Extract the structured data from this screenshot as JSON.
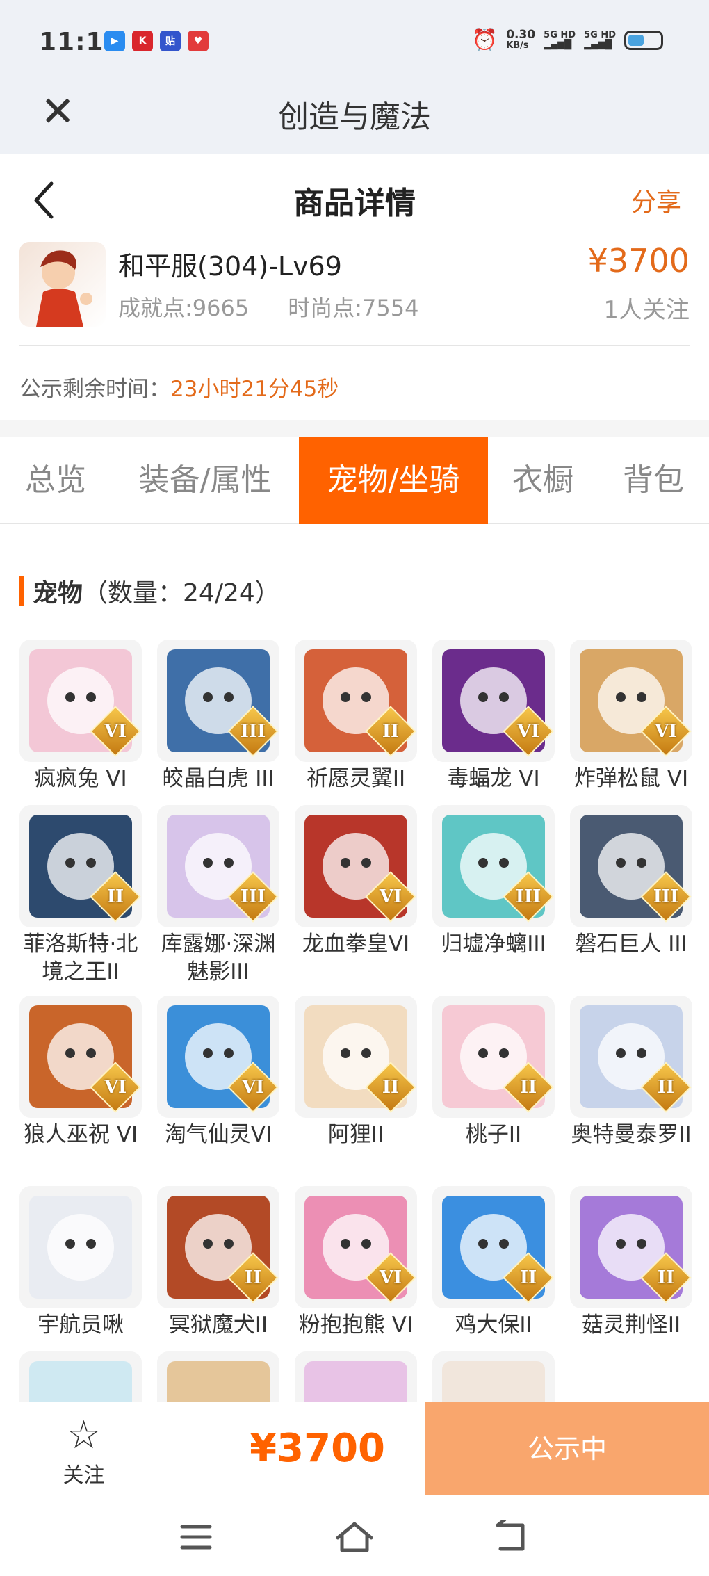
{
  "status_bar": {
    "time": "11:15",
    "net_speed_value": "0.30",
    "net_speed_unit": "KB/s",
    "signal1": "5G HD",
    "signal2": "5G HD"
  },
  "app": {
    "title": "创造与魔法",
    "close_icon": "close-icon"
  },
  "navbar": {
    "title": "商品详情",
    "share": "分享",
    "back_icon": "chevron-left-icon"
  },
  "product": {
    "name": "和平服(304)-Lv69",
    "achievement": "成就点:9665",
    "fashion": "时尚点:7554",
    "price": "¥3700",
    "followers": "1人关注"
  },
  "notice": {
    "label": "公示剩余时间：",
    "remaining": "23小时21分45秒"
  },
  "tabs": [
    {
      "label": "总览",
      "active": false
    },
    {
      "label": "装备/属性",
      "active": false
    },
    {
      "label": "宠物/坐骑",
      "active": true
    },
    {
      "label": "衣橱",
      "active": false
    },
    {
      "label": "背包",
      "active": false
    }
  ],
  "pets_section": {
    "title": "宠物",
    "count": "（数量：24/24）"
  },
  "pets": [
    {
      "name": "疯疯兔 VI",
      "grade": "VI",
      "color": "#f3c7d6"
    },
    {
      "name": "皎晶白虎 III",
      "grade": "III",
      "color": "#3f6fa8"
    },
    {
      "name": "祈愿灵翼II",
      "grade": "II",
      "color": "#d5613a"
    },
    {
      "name": "毒蝠龙 VI",
      "grade": "VI",
      "color": "#6b2c8c"
    },
    {
      "name": "炸弹松鼠 VI",
      "grade": "VI",
      "color": "#d9a766"
    },
    {
      "name": "菲洛斯特·北境之王II",
      "grade": "II",
      "color": "#2d4a6e"
    },
    {
      "name": "库露娜·深渊魅影III",
      "grade": "III",
      "color": "#d7c4ea"
    },
    {
      "name": "龙血拳皇VI",
      "grade": "VI",
      "color": "#b8362a"
    },
    {
      "name": "归墟净螭III",
      "grade": "III",
      "color": "#5fc6c5"
    },
    {
      "name": "磐石巨人 III",
      "grade": "III",
      "color": "#4a5a72"
    },
    {
      "name": "狼人巫祝 VI",
      "grade": "VI",
      "color": "#c9652a"
    },
    {
      "name": "淘气仙灵VI",
      "grade": "VI",
      "color": "#3b8fd9"
    },
    {
      "name": "阿狸II",
      "grade": "II",
      "color": "#f2dcc0"
    },
    {
      "name": "桃子II",
      "grade": "II",
      "color": "#f6c9d4"
    },
    {
      "name": "奥特曼泰罗II",
      "grade": "II",
      "color": "#c7d3ea"
    },
    {
      "name": "宇航员啾",
      "grade": "",
      "color": "#e9ecf2"
    },
    {
      "name": "冥狱魔犬II",
      "grade": "II",
      "color": "#b34a26"
    },
    {
      "name": "粉抱抱熊 VI",
      "grade": "VI",
      "color": "#ec8fb4"
    },
    {
      "name": "鸡大保II",
      "grade": "II",
      "color": "#3b8fe0"
    },
    {
      "name": "菇灵荆怪II",
      "grade": "II",
      "color": "#a57ad9"
    }
  ],
  "partial_row_colors": [
    "#cfe9f2",
    "#e5c69a",
    "#e8c3e6",
    "#f1e6dc"
  ],
  "bottom": {
    "follow": "关注",
    "price": "¥3700",
    "status": "公示中"
  },
  "accent": "#ff6200"
}
